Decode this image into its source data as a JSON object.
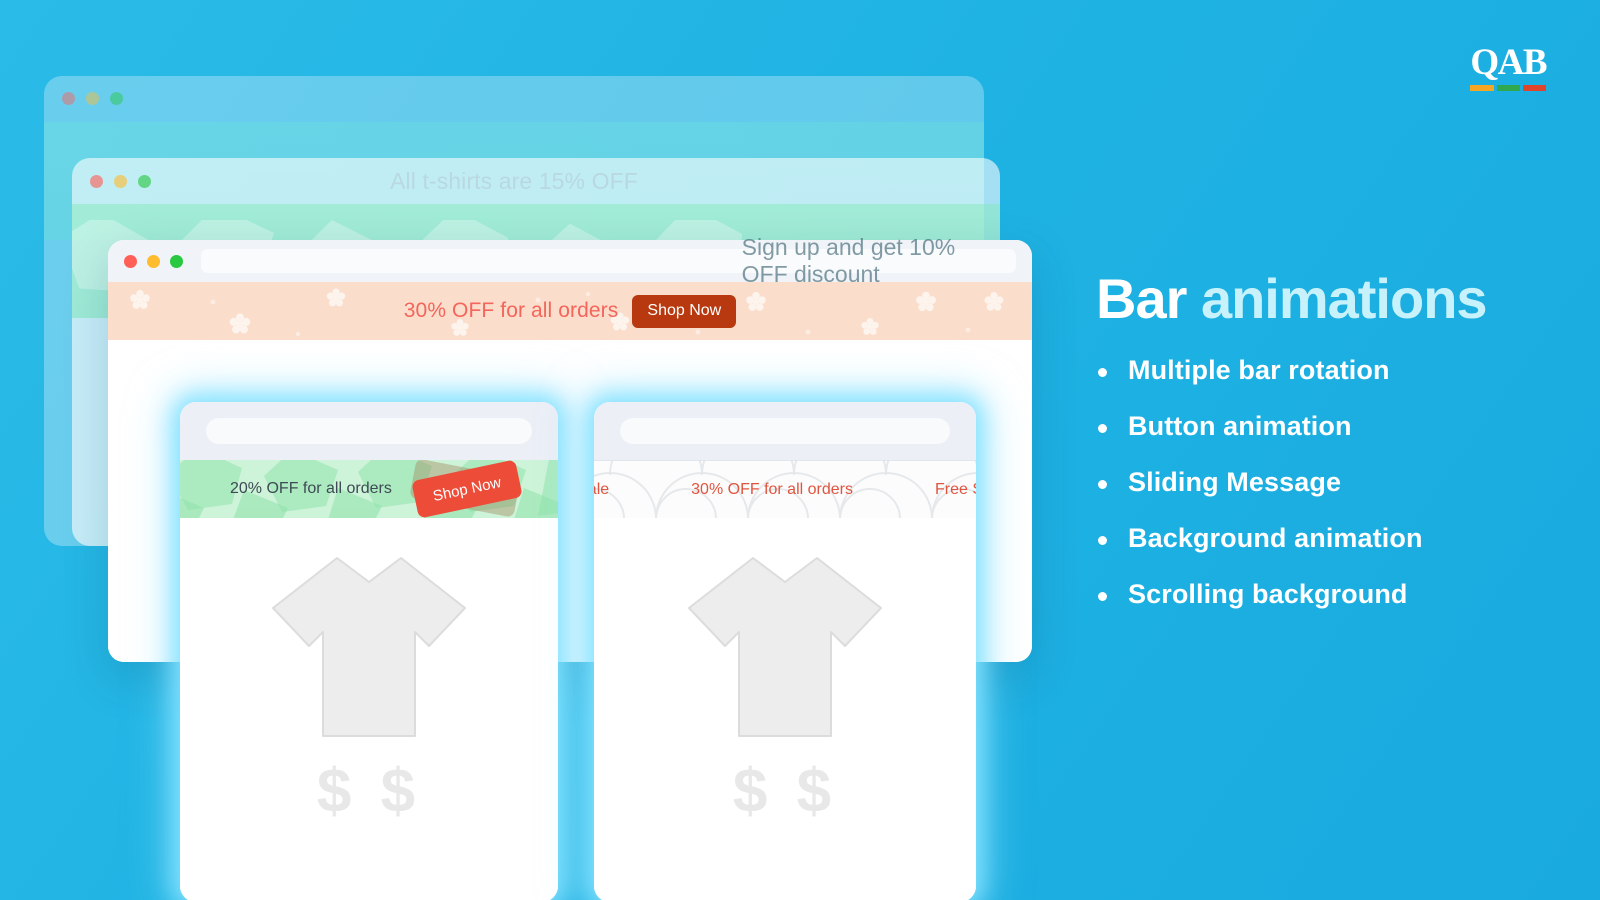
{
  "brand": {
    "logo_text": "QAB",
    "stripe_colors": [
      "#F5A623",
      "#2FA84F",
      "#E0452B"
    ]
  },
  "theme": {
    "background": "#1FB3E3",
    "heading_white": "#FFFFFF",
    "heading_accent": "#C8F2FB"
  },
  "panel": {
    "title_part1": "Bar ",
    "title_part2": "animations",
    "features": [
      "Multiple bar rotation",
      "Button animation",
      "Sliding Message",
      "Background animation",
      "Scrolling background"
    ]
  },
  "windows": {
    "back1": {
      "bar_message": "All t-shirts are 15% OFF",
      "dots": [
        "red",
        "yellow",
        "green"
      ]
    },
    "back2": {
      "bar_message": "Sign up and get 10% OFF discount",
      "dots": [
        "red",
        "yellow",
        "green"
      ]
    },
    "front": {
      "dots": [
        "red",
        "yellow",
        "green"
      ],
      "url_value": "",
      "url_placeholder": "",
      "bar_message": "30% OFF for all orders",
      "bar_button_label": "Shop Now",
      "bar_bg_color": "#FBDDCB",
      "bar_text_color": "#F4655C",
      "bar_button_color": "#B8390F"
    }
  },
  "sub_windows": [
    {
      "name": "button-animation-demo",
      "url_value": "",
      "bar_message": "20% OFF for all orders",
      "bar_button_label": "Shop Now",
      "bar_button_ghost_label": "Shop Now",
      "bar_bg_color": "#CDF3D8",
      "bar_text_color": "#3E4A54",
      "bar_button_color": "#EC4C38",
      "product_price": "$ $"
    },
    {
      "name": "sliding-message-demo",
      "url_value": "",
      "bar_messages": [
        "iday sale",
        "30% OFF for all orders",
        "Free Shipp"
      ],
      "bar_bg_color": "#FCFCFC",
      "bar_text_color": "#E0553F",
      "product_price": "$ $"
    }
  ]
}
